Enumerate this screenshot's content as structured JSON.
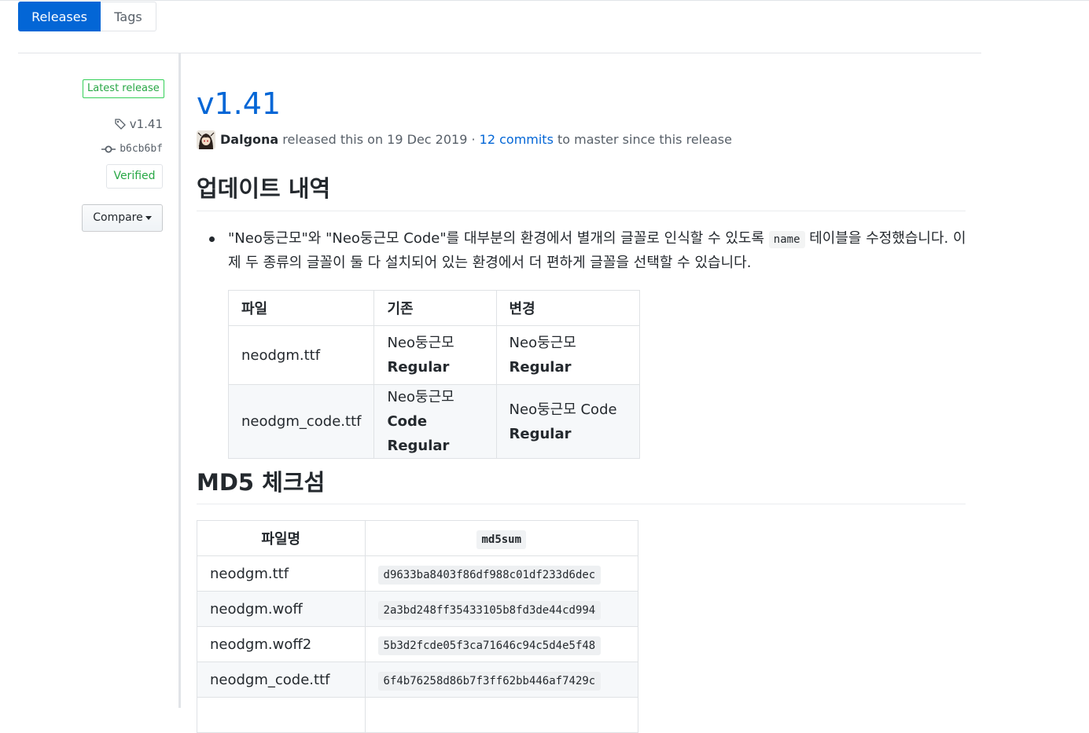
{
  "tabs": {
    "releases": "Releases",
    "tags": "Tags"
  },
  "sidebar": {
    "latest_badge": "Latest release",
    "tag": "v1.41",
    "commit": "b6cb6bf",
    "verified": "Verified",
    "compare": "Compare"
  },
  "release": {
    "title": "v1.41",
    "author": "Dalgona",
    "released_text": "released this on 19 Dec 2019 ·",
    "commits_link": "12 commits",
    "commits_suffix": "to master since this release"
  },
  "update_section": {
    "heading": "업데이트 내역",
    "bullet_before": "\"Neo둥근모\"와 \"Neo둥근모 Code\"를 대부분의 환경에서 별개의 글꼴로 인식할 수 있도록",
    "bullet_code": "name",
    "bullet_after": "테이블을 수정했습니다. 이제 두 종류의 글꼴이 둘 다 설치되어 있는 환경에서 더 편하게 글꼴을 선택할 수 있습니다.",
    "table": {
      "headers": [
        "파일",
        "기존",
        "변경"
      ],
      "rows": [
        {
          "file": "neodgm.ttf",
          "old_1": "Neo둥근모",
          "old_2": "Regular",
          "new_1": "Neo둥근모",
          "new_2": "Regular"
        },
        {
          "file": "neodgm_code.ttf",
          "old_1": "Neo둥근모",
          "old_2": "Code Regular",
          "new_1": "Neo둥근모 Code",
          "new_2": "Regular"
        }
      ]
    }
  },
  "md5_section": {
    "heading": "MD5 체크섬",
    "table": {
      "header_file": "파일명",
      "header_sum": "md5sum",
      "rows": [
        {
          "file": "neodgm.ttf",
          "sum": "d9633ba8403f86df988c01df233d6dec"
        },
        {
          "file": "neodgm.woff",
          "sum": "2a3bd248ff35433105b8fd3de44cd994"
        },
        {
          "file": "neodgm.woff2",
          "sum": "5b3d2fcde05f3ca71646c94c5d4e5f48"
        },
        {
          "file": "neodgm_code.ttf",
          "sum": "6f4b76258d86b7f3ff62bb446af7429c"
        }
      ]
    }
  },
  "colors": {
    "accent": "#0366d6",
    "success": "#28a745",
    "border": "#e1e4e8"
  },
  "icons": {
    "tag": "tag-icon",
    "commit": "git-commit-icon",
    "caret": "caret-down-icon"
  }
}
